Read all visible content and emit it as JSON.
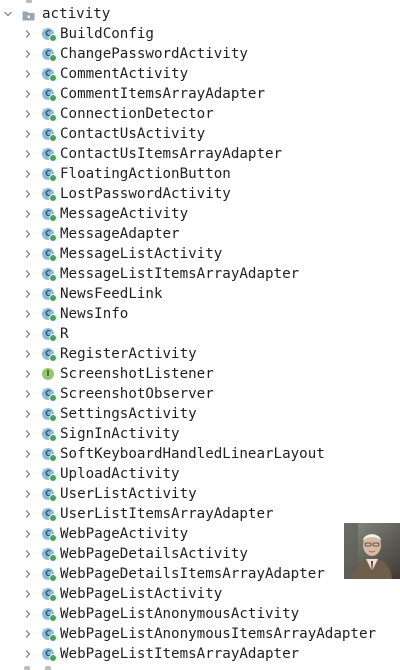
{
  "tree": {
    "folder": {
      "label": "activity",
      "expand_icon": "chevron-down-icon",
      "icon": "package-folder-icon"
    },
    "items": [
      {
        "label": "BuildConfig",
        "kind": "class"
      },
      {
        "label": "ChangePasswordActivity",
        "kind": "class"
      },
      {
        "label": "CommentActivity",
        "kind": "class"
      },
      {
        "label": "CommentItemsArrayAdapter",
        "kind": "class"
      },
      {
        "label": "ConnectionDetector",
        "kind": "class"
      },
      {
        "label": "ContactUsActivity",
        "kind": "class"
      },
      {
        "label": "ContactUsItemsArrayAdapter",
        "kind": "class"
      },
      {
        "label": "FloatingActionButton",
        "kind": "class"
      },
      {
        "label": "LostPasswordActivity",
        "kind": "class"
      },
      {
        "label": "MessageActivity",
        "kind": "class"
      },
      {
        "label": "MessageAdapter",
        "kind": "class"
      },
      {
        "label": "MessageListActivity",
        "kind": "class"
      },
      {
        "label": "MessageListItemsArrayAdapter",
        "kind": "class"
      },
      {
        "label": "NewsFeedLink",
        "kind": "class"
      },
      {
        "label": "NewsInfo",
        "kind": "class"
      },
      {
        "label": "R",
        "kind": "class"
      },
      {
        "label": "RegisterActivity",
        "kind": "class"
      },
      {
        "label": "ScreenshotListener",
        "kind": "interface"
      },
      {
        "label": "ScreenshotObserver",
        "kind": "class"
      },
      {
        "label": "SettingsActivity",
        "kind": "class"
      },
      {
        "label": "SignInActivity",
        "kind": "class"
      },
      {
        "label": "SoftKeyboardHandledLinearLayout",
        "kind": "class"
      },
      {
        "label": "UploadActivity",
        "kind": "class"
      },
      {
        "label": "UserListActivity",
        "kind": "class"
      },
      {
        "label": "UserListItemsArrayAdapter",
        "kind": "class"
      },
      {
        "label": "WebPageActivity",
        "kind": "class"
      },
      {
        "label": "WebPageDetailsActivity",
        "kind": "class"
      },
      {
        "label": "WebPageDetailsItemsArrayAdapter",
        "kind": "class"
      },
      {
        "label": "WebPageListActivity",
        "kind": "class"
      },
      {
        "label": "WebPageListAnonymousActivity",
        "kind": "class"
      },
      {
        "label": "WebPageListAnonymousItemsArrayAdapter",
        "kind": "class"
      },
      {
        "label": "WebPageListItemsArrayAdapter",
        "kind": "class"
      }
    ]
  },
  "icons": {
    "class": {
      "letter": "C",
      "color": "#8dbbd8",
      "name": "class-icon"
    },
    "interface": {
      "letter": "I",
      "color": "#95c46f",
      "name": "interface-icon"
    },
    "item_expand": "chevron-right-icon",
    "badge": "source-root-badge-icon"
  },
  "colors": {
    "text": "#1f1f1f",
    "arrow": "#7a7a7a",
    "folder": "#9aa7b0",
    "background": "#ffffff"
  },
  "overlay": {
    "icon": "user-avatar-photo"
  }
}
